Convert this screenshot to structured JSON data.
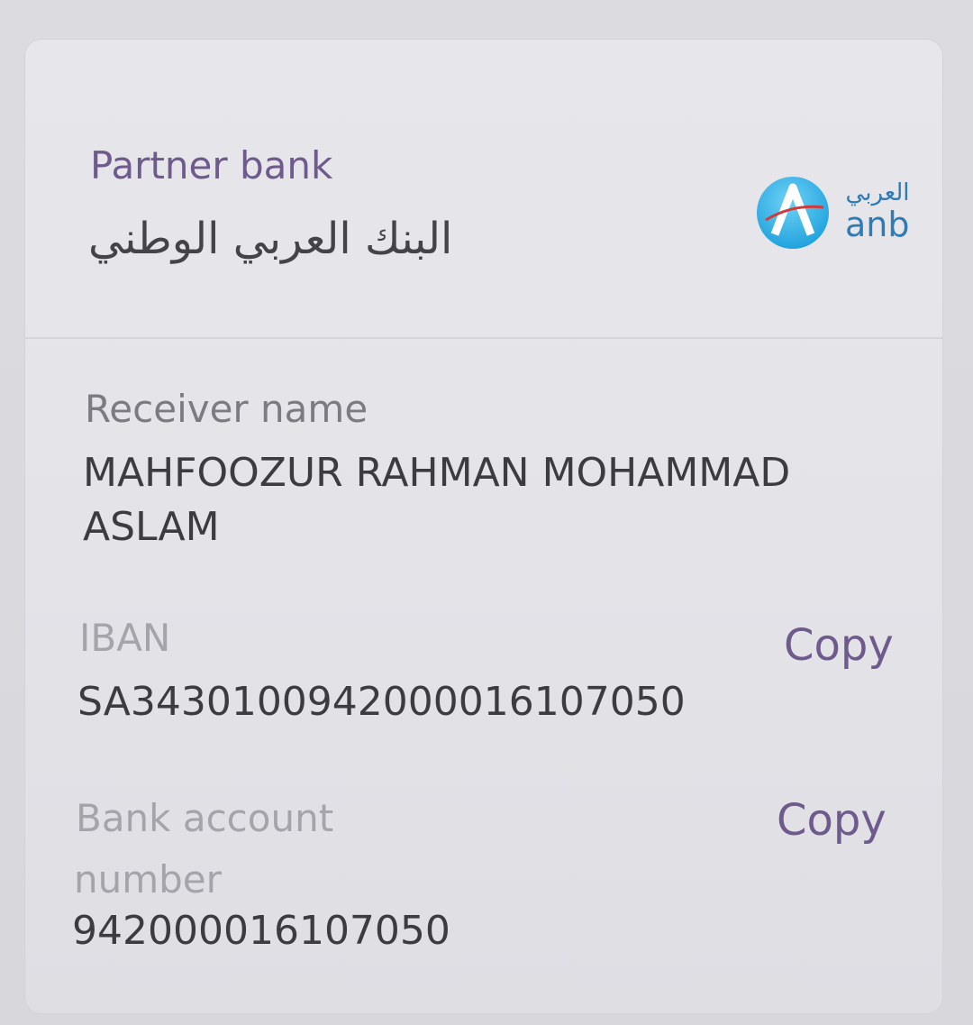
{
  "partner_bank": {
    "label": "Partner bank",
    "name": "البنك العربي الوطني",
    "logo": {
      "icon": "anb-logo-icon",
      "arabic_text": "العربي",
      "text": "anb",
      "color": "#2f7bb6"
    }
  },
  "receiver": {
    "label": "Receiver name",
    "name_line1": "MAHFOOZUR RAHMAN MOHAMMAD",
    "name_line2": "ASLAM"
  },
  "iban": {
    "label": "IBAN",
    "value": "SA3430100942000016107050",
    "copy_label": "Copy"
  },
  "account": {
    "label_line1": "Bank account",
    "label_line2": "number",
    "value": "942000016107050",
    "copy_label": "Copy"
  },
  "colors": {
    "accent": "#6e5a8c",
    "text": "#3b3b40",
    "muted": "#a4a4ab"
  }
}
